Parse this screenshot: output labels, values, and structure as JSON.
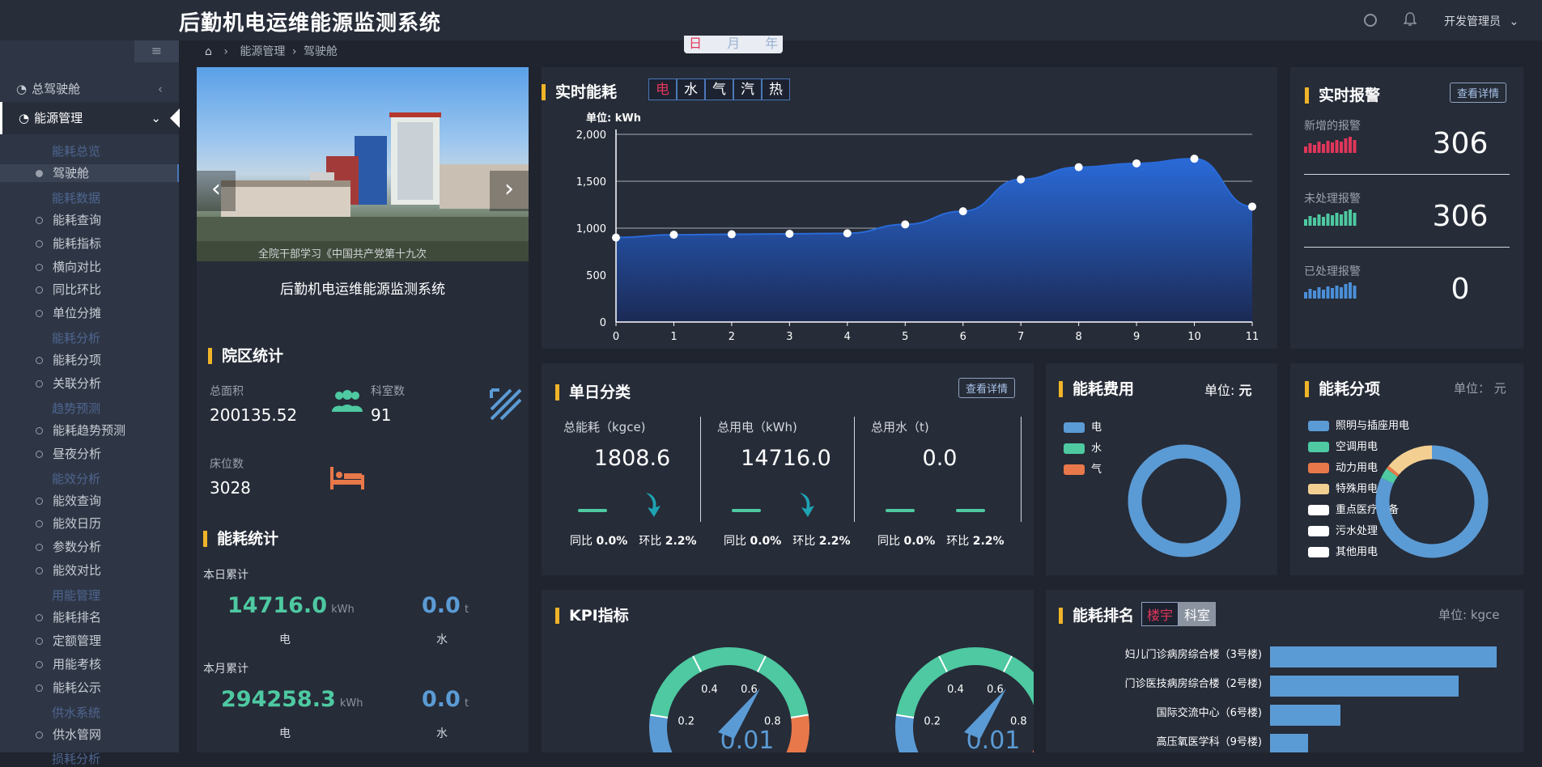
{
  "app": {
    "title": "后勤机电运维能源监测系统",
    "user": "开发管理员"
  },
  "period_tabs": [
    "日",
    "月",
    "年"
  ],
  "breadcrumb": [
    "能源管理",
    "驾驶舱"
  ],
  "sidebar": {
    "top": [
      {
        "label": "总驾驶舱"
      },
      {
        "label": "能源管理"
      }
    ],
    "items": [
      {
        "type": "cat",
        "label": "能耗总览"
      },
      {
        "type": "item",
        "label": "驾驶舱",
        "active": true
      },
      {
        "type": "cat",
        "label": "能耗数据"
      },
      {
        "type": "item",
        "label": "能耗查询"
      },
      {
        "type": "item",
        "label": "能耗指标"
      },
      {
        "type": "item",
        "label": "横向对比"
      },
      {
        "type": "item",
        "label": "同比环比"
      },
      {
        "type": "item",
        "label": "单位分摊"
      },
      {
        "type": "cat",
        "label": "能耗分析"
      },
      {
        "type": "item",
        "label": "能耗分项"
      },
      {
        "type": "item",
        "label": "关联分析"
      },
      {
        "type": "cat",
        "label": "趋势预测"
      },
      {
        "type": "item",
        "label": "能耗趋势预测"
      },
      {
        "type": "item",
        "label": "昼夜分析"
      },
      {
        "type": "cat",
        "label": "能效分析"
      },
      {
        "type": "item",
        "label": "能效查询"
      },
      {
        "type": "item",
        "label": "能效日历"
      },
      {
        "type": "item",
        "label": "参数分析"
      },
      {
        "type": "item",
        "label": "能效对比"
      },
      {
        "type": "cat",
        "label": "用能管理"
      },
      {
        "type": "item",
        "label": "能耗排名"
      },
      {
        "type": "item",
        "label": "定额管理"
      },
      {
        "type": "item",
        "label": "用能考核"
      },
      {
        "type": "item",
        "label": "能耗公示"
      },
      {
        "type": "cat",
        "label": "供水系统"
      },
      {
        "type": "item",
        "label": "供水管网"
      },
      {
        "type": "cat",
        "label": "损耗分析"
      }
    ]
  },
  "banner": {
    "caption": "全院干部学习《中国共产党第十九次",
    "title": "后勤机电运维能源监测系统"
  },
  "campus": {
    "title": "院区统计",
    "area_label": "总面积",
    "area_value": "200135.52",
    "dept_label": "科室数",
    "dept_value": "91",
    "bed_label": "床位数",
    "bed_value": "3028"
  },
  "energy_stats": {
    "title": "能耗统计",
    "day_label": "本日累计",
    "day_elec": "14716.0",
    "day_elec_unit": "kWh",
    "day_water": "0.0",
    "day_water_unit": "t",
    "month_label": "本月累计",
    "month_elec": "294258.3",
    "month_elec_unit": "kWh",
    "month_water": "0.0",
    "month_water_unit": "t",
    "elec_label": "电",
    "water_label": "水"
  },
  "realtime": {
    "title": "实时能耗",
    "tabs": [
      "电",
      "水",
      "气",
      "汽",
      "热"
    ],
    "unit_label": "单位:  kWh"
  },
  "chart_data": {
    "type": "area",
    "x": [
      0,
      1,
      2,
      3,
      4,
      5,
      6,
      7,
      8,
      9,
      10,
      11
    ],
    "series": [
      {
        "values": [
          900,
          930,
          935,
          940,
          945,
          1040,
          1180,
          1520,
          1650,
          1690,
          1740,
          1230
        ]
      }
    ],
    "ylim": [
      0,
      2000
    ],
    "yticks": [
      "0",
      "500",
      "1,000",
      "1,500",
      "2,000"
    ],
    "xticks": [
      "0",
      "1",
      "2",
      "3",
      "4",
      "5",
      "6",
      "7",
      "8",
      "9",
      "10",
      "11"
    ],
    "grid": true
  },
  "alarms": {
    "title": "实时报警",
    "detail_label": "查看详情",
    "rows": [
      {
        "label": "新增的报警",
        "value": "306",
        "color": "#e0365a"
      },
      {
        "label": "未处理报警",
        "value": "306",
        "color": "#4ec9a1"
      },
      {
        "label": "已处理报警",
        "value": "0",
        "color": "#4a8fd8"
      }
    ]
  },
  "daily": {
    "title": "单日分类",
    "detail_label": "查看详情",
    "cols": [
      {
        "label": "总能耗（kgce)",
        "value": "1808.6",
        "yoy_label": "同比",
        "yoy": "0.0%",
        "mom_label": "环比",
        "mom": "2.2%",
        "down": true
      },
      {
        "label": "总用电（kWh)",
        "value": "14716.0",
        "yoy_label": "同比",
        "yoy": "0.0%",
        "mom_label": "环比",
        "mom": "2.2%",
        "down": true
      },
      {
        "label": "总用水（t)",
        "value": "0.0",
        "yoy_label": "同比",
        "yoy": "0.0%",
        "mom_label": "环比",
        "mom": "2.2%",
        "down": false
      }
    ]
  },
  "cost": {
    "title": "能耗费用",
    "unit_label": "单位:",
    "unit": "元",
    "legend": [
      {
        "label": "电",
        "color": "#5b9bd5"
      },
      {
        "label": "水",
        "color": "#4ec9a1"
      },
      {
        "label": "气",
        "color": "#e8784a"
      }
    ],
    "donut": [
      1.0,
      0,
      0
    ]
  },
  "items": {
    "title": "能耗分项",
    "unit_label": "单位：",
    "unit": "元",
    "legend": [
      {
        "label": "照明与插座用电",
        "color": "#5b9bd5"
      },
      {
        "label": "空调用电",
        "color": "#4ec9a1"
      },
      {
        "label": "动力用电",
        "color": "#e8784a"
      },
      {
        "label": "特殊用电",
        "color": "#f3cf91"
      },
      {
        "label": "重点医疗设备",
        "color": "#ffffff"
      },
      {
        "label": "污水处理",
        "color": "#ffffff"
      },
      {
        "label": "其他用电",
        "color": "#ffffff"
      }
    ],
    "donut": [
      0.82,
      0.03,
      0.01,
      0.14,
      0,
      0,
      0
    ]
  },
  "kpi": {
    "title": "KPI指标",
    "ticks": [
      "0.2",
      "0.4",
      "0.6",
      "0.8"
    ],
    "value_partial": "0.01"
  },
  "ranking": {
    "title": "能耗排名",
    "tabs": [
      "楼宇",
      "科室"
    ],
    "unit_label": "单位:",
    "unit": "kgce",
    "categories": [
      "妇儿门诊病房综合楼（3号楼)",
      "门诊医技病房综合楼（2号楼)",
      "国际交流中心（6号楼)",
      "高压氧医学科（9号楼)"
    ],
    "values": [
      280,
      233,
      87,
      47
    ]
  }
}
